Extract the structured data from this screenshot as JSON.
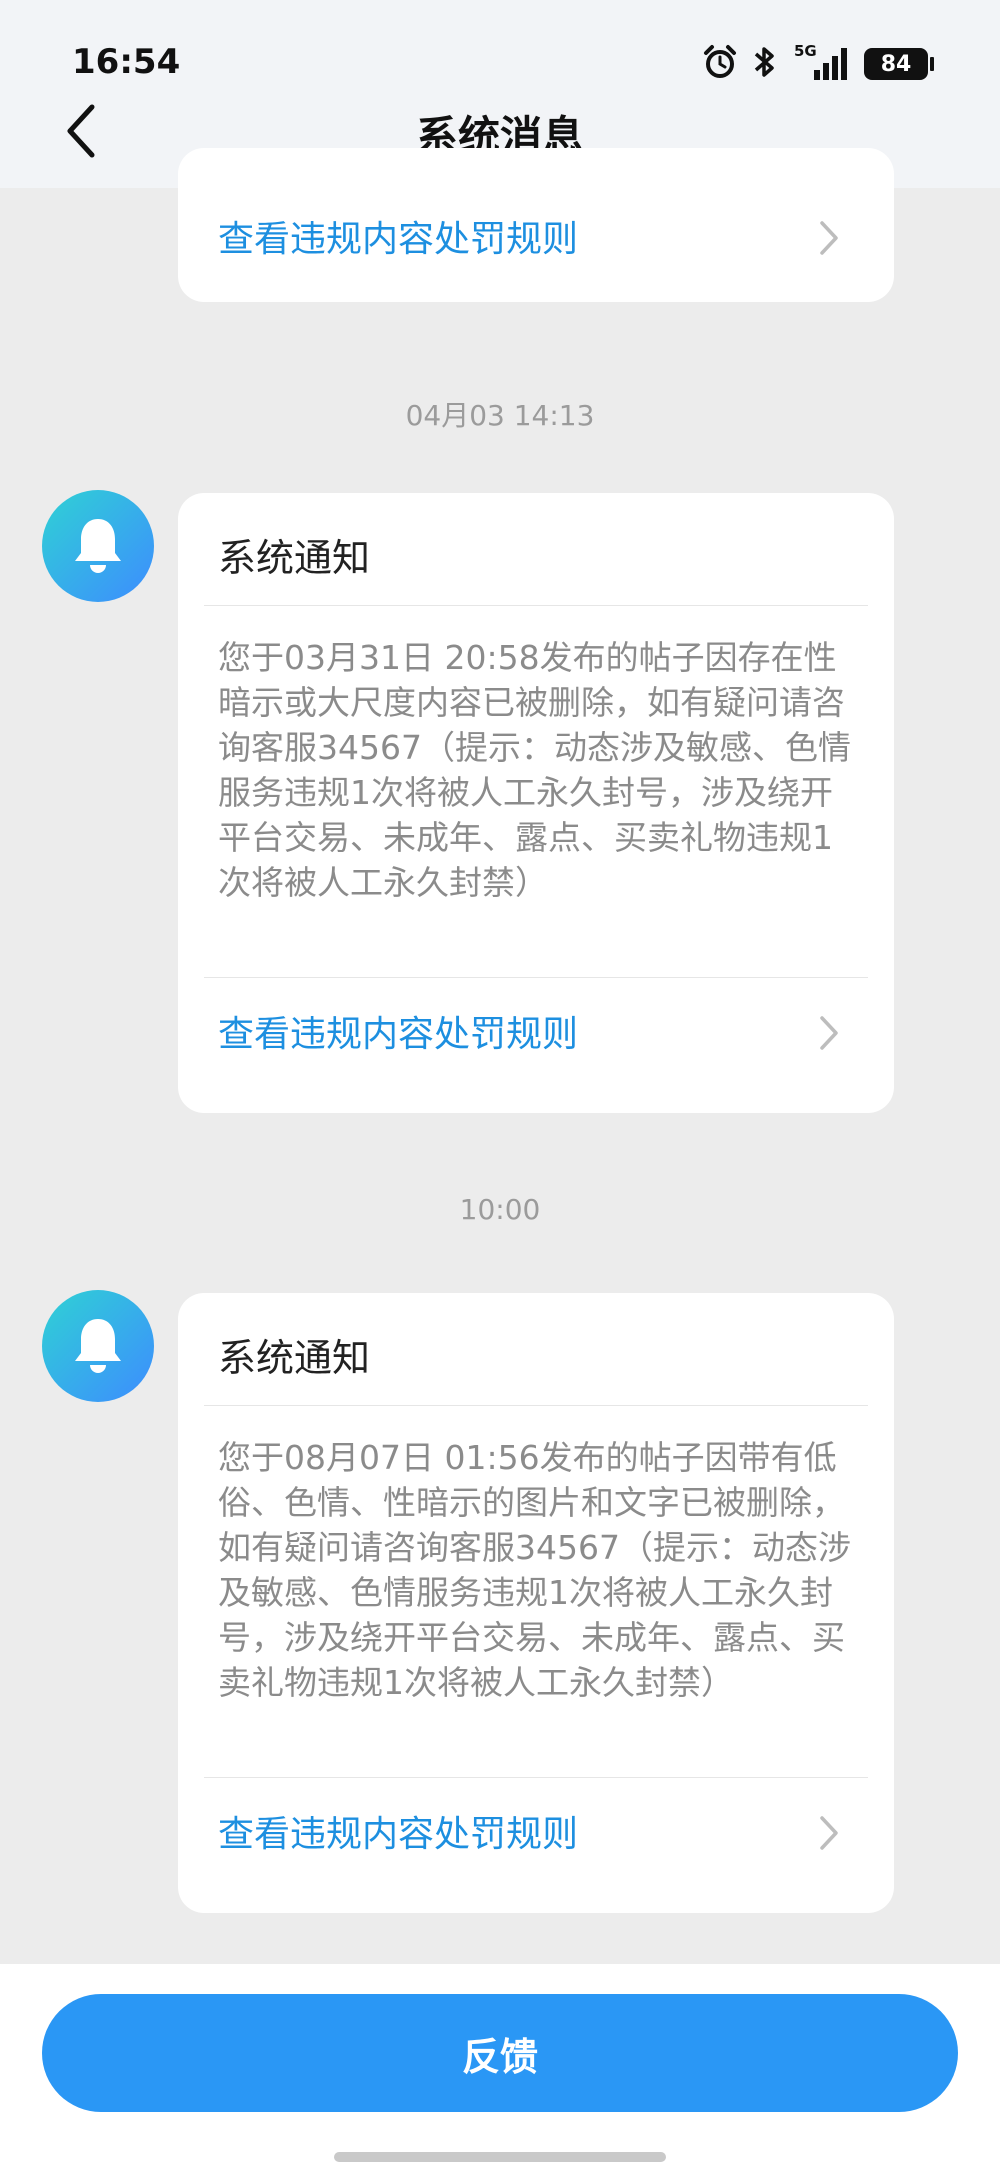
{
  "status_bar": {
    "time": "16:54",
    "network": "5G",
    "battery": "84"
  },
  "nav": {
    "title": "系统消息"
  },
  "messages": [
    {
      "partial": true,
      "link": "查看违规内容处罚规则"
    },
    {
      "timestamp": "04月03 14:13",
      "title": "系统通知",
      "body": "您于03月31日 20:58发布的帖子因存在性暗示或大尺度内容已被删除，如有疑问请咨询客服34567（提示：动态涉及敏感、色情服务违规1次将被人工永久封号，涉及绕开平台交易、未成年、露点、买卖礼物违规1次将被人工永久封禁）",
      "link": "查看违规内容处罚规则"
    },
    {
      "timestamp": "10:00",
      "title": "系统通知",
      "body": "您于08月07日 01:56发布的帖子因带有低俗、色情、性暗示的图片和文字已被删除，如有疑问请咨询客服34567（提示：动态涉及敏感、色情服务违规1次将被人工永久封号，涉及绕开平台交易、未成年、露点、买卖礼物违规1次将被人工永久封禁）",
      "link": "查看违规内容处罚规则"
    }
  ],
  "footer": {
    "feedback_label": "反馈"
  },
  "colors": {
    "accent": "#2a97f5",
    "link": "#1d8fe0",
    "avatar_start": "#2fd2d4",
    "avatar_end": "#3d8cff"
  },
  "icons": [
    "alarm-icon",
    "bluetooth-icon",
    "signal-icon",
    "battery-icon",
    "back-arrow-icon",
    "bell-icon",
    "chevron-right-icon"
  ]
}
